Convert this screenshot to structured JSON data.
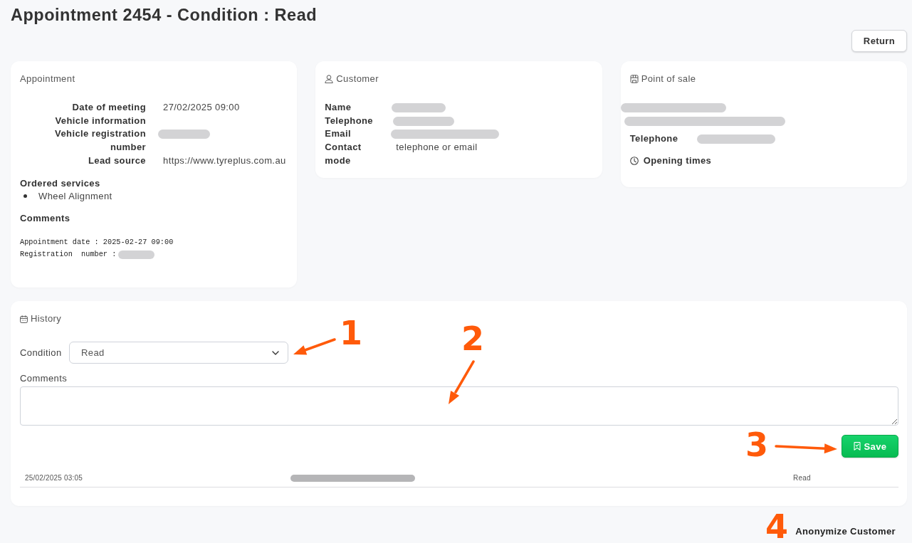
{
  "page": {
    "title": "Appointment 2454 - Condition : Read"
  },
  "return_button": {
    "label": "Return"
  },
  "appointment_card": {
    "title": "Appointment",
    "fields": [
      {
        "label": "Date of meeting",
        "value": "27/02/2025 09:00",
        "redacted": false
      },
      {
        "label": "Vehicle information",
        "redacted": false
      },
      {
        "label": "Vehicle registration number",
        "redacted": true
      },
      {
        "label": "Lead source",
        "value": "https://www.tyreplus.com.au",
        "redacted": false
      }
    ],
    "ordered_services": {
      "heading": "Ordered services",
      "items": [
        "Wheel Alignment"
      ]
    },
    "comments": {
      "heading": "Comments",
      "lines": [
        {
          "text": "Appointment date : 2025-02-27 09:00",
          "redacted": false
        },
        {
          "text": "Registration  number :",
          "redacted": true
        }
      ]
    }
  },
  "customer_card": {
    "title": "Customer",
    "fields": [
      {
        "label": "Name",
        "redacted": true
      },
      {
        "label": "Telephone",
        "redacted": true
      },
      {
        "label": "Email",
        "redacted": true
      },
      {
        "label": "Contact mode",
        "value": "telephone or email",
        "redacted": false
      }
    ]
  },
  "point_of_sale_card": {
    "title": "Point of sale",
    "lines": [
      {
        "redacted": true
      },
      {
        "redacted": true
      }
    ],
    "fields": [
      {
        "label": "Telephone",
        "redacted": true
      }
    ],
    "opening_times": {
      "label": "Opening times"
    }
  },
  "history": {
    "title": "History",
    "condition": {
      "label": "Condition",
      "value": "Read"
    },
    "comments": {
      "label": "Comments"
    },
    "save_button": {
      "label": "Save"
    },
    "entries": [
      {
        "date": "25/02/2025 03:05",
        "redacted": true,
        "condition": "Read"
      }
    ]
  },
  "anonymize_link": {
    "label": "Anonymize Customer"
  },
  "annotations": [
    {
      "label": "1"
    },
    {
      "label": "2"
    },
    {
      "label": "3"
    },
    {
      "label": "4"
    }
  ]
}
